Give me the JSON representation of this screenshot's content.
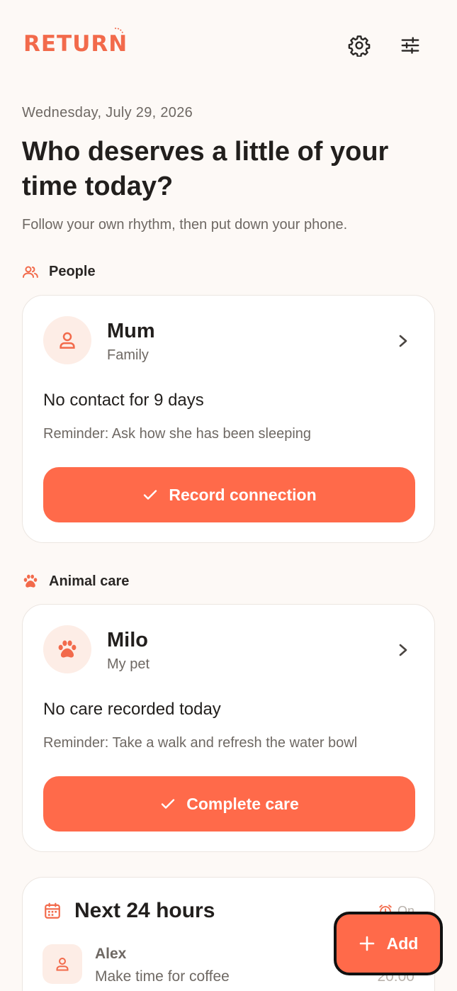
{
  "colors": {
    "accent": "#FF6A4A",
    "background": "#FDF9F6",
    "card": "#FFFFFF",
    "muted_text": "#6E6863",
    "avatar_bg": "#FDEDE6"
  },
  "header": {
    "logo_text": "RETURN",
    "settings_icon": "gear-icon",
    "filter_icon": "sliders-icon"
  },
  "intro": {
    "date": "Wednesday, July 29, 2026",
    "headline": "Who deserves a little of your time today?",
    "subline": "Follow your own rhythm, then put down your phone."
  },
  "people_section": {
    "label": "People",
    "icon": "people-icon",
    "card": {
      "name": "Mum",
      "relation": "Family",
      "status": "No contact for 9 days",
      "reminder": "Reminder: Ask how she has been sleeping",
      "action_label": "Record connection"
    }
  },
  "animal_section": {
    "label": "Animal care",
    "icon": "paw-icon",
    "card": {
      "name": "Milo",
      "relation": "My pet",
      "status": "No care recorded today",
      "reminder": "Reminder: Take a walk and refresh the water bowl",
      "action_label": "Complete care"
    }
  },
  "next_24": {
    "title": "Next 24 hours",
    "toggle_label": "On",
    "events": [
      {
        "name": "Alex",
        "description": "Make time for coffee",
        "time": "20:00"
      }
    ]
  },
  "fab": {
    "label": "Add"
  }
}
